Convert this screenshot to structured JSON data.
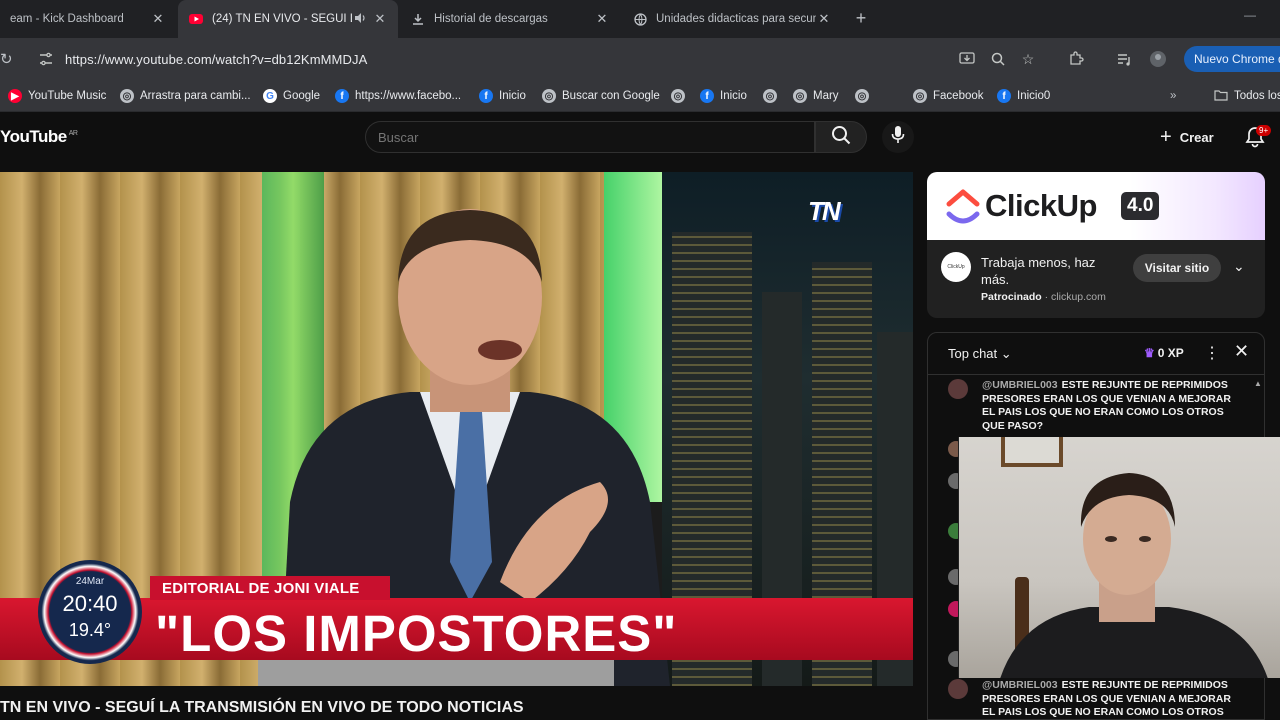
{
  "browser": {
    "tabs": [
      {
        "title": "eam - Kick Dashboard"
      },
      {
        "title": "(24) TN EN VIVO - SEGUÍ LA"
      },
      {
        "title": "Historial de descargas"
      },
      {
        "title": "Unidades didacticas para secun"
      }
    ],
    "url": "https://www.youtube.com/watch?v=db12KmMMDJA",
    "chrome_button": "Nuevo Chrome d",
    "bookmarks": [
      {
        "label": "YouTube Music",
        "icon": "youtube-icon"
      },
      {
        "label": "Arrastra para cambi...",
        "icon": "globe-icon"
      },
      {
        "label": "Google",
        "icon": "google-icon"
      },
      {
        "label": "https://www.facebo...",
        "icon": "facebook-icon"
      },
      {
        "label": "Inicio",
        "icon": "facebook-icon"
      },
      {
        "label": "Buscar con Google",
        "icon": "globe-icon"
      },
      {
        "label": "",
        "icon": "globe-icon"
      },
      {
        "label": "Inicio",
        "icon": "facebook-icon"
      },
      {
        "label": "",
        "icon": "globe-icon"
      },
      {
        "label": "Mary",
        "icon": "globe-icon"
      },
      {
        "label": "",
        "icon": "globe-icon"
      },
      {
        "label": "Facebook",
        "icon": "globe-icon"
      },
      {
        "label": "Inicio0",
        "icon": "facebook-icon"
      }
    ],
    "bookmarks_folder": "Todos los"
  },
  "youtube": {
    "logo": "YouTube",
    "country": "AR",
    "search_placeholder": "Buscar",
    "create_label": "Crear",
    "notif_count": "9+"
  },
  "video": {
    "channel_logo": "TN",
    "lower_third_tag": "EDITORIAL DE JONI VIALE",
    "headline": "\"LOS IMPOSTORES\"",
    "clock_date": "24Mar",
    "clock_time": "20:40",
    "clock_temp": "19.4°",
    "title": "TN EN VIVO - SEGUÍ LA TRANSMISIÓN EN VIVO DE TODO NOTICIAS"
  },
  "ad": {
    "brand": "ClickUp",
    "version": "4.0",
    "avatar_text": "ClickUp",
    "tagline": "Trabaja menos, haz más.",
    "sponsored": "Patrocinado",
    "domain": "clickup.com",
    "visit_label": "Visitar sitio"
  },
  "chat": {
    "mode": "Top chat",
    "xp": "0 XP",
    "messages": [
      {
        "author": "@UMBRIEL003",
        "text": "ESTE REJUNTE DE REPRIMIDOS PRESORES ERAN LOS QUE VENIAN A MEJORAR EL PAIS LOS QUE NO ERAN COMO LOS OTROS QUE PASO?"
      },
      {
        "author": "@UMBRIEL003",
        "text": "ESTE REJUNTE DE REPRIMIDOS PRESORES ERAN LOS QUE VENIAN A MEJORAR EL PAIS LOS QUE NO ERAN COMO LOS OTROS QUE PASO?"
      }
    ]
  },
  "colors": {
    "youtube_bg": "#0f0f0f",
    "tn_red": "#c8102e",
    "chrome_blue": "#1a5fb4",
    "clickup_purple": "#7b68ee"
  }
}
